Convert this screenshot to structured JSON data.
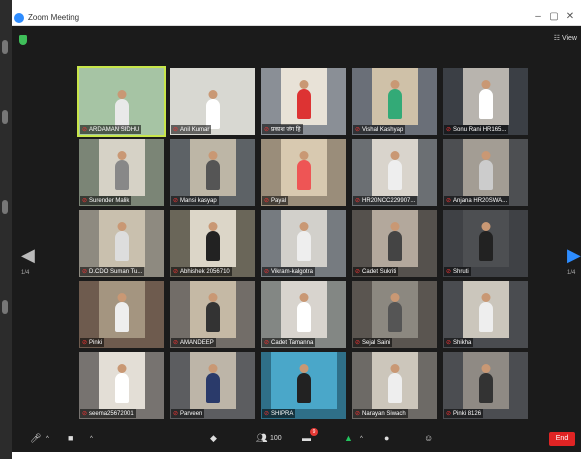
{
  "window": {
    "title": "Zoom Meeting",
    "minimize": "–",
    "restore": "▢",
    "close": "✕"
  },
  "header": {
    "view_label": "☷ View"
  },
  "gallery": {
    "page_left": "1/4",
    "page_right": "1/4",
    "participants": [
      "ARDAMAN SIDHU",
      "Anil Kumar",
      "प्रकाश जंग हि",
      "Vishal Kashyap",
      "Sonu Rani HR165...",
      "Surender Malik",
      "Mansi kasyap",
      "Payal",
      "HR20NCC229907...",
      "Anjana HR20SWA...",
      "D.CDO Suman Tu...",
      "Abhishek 2056710",
      "Vikram-kalgotra",
      "Cadet Sukriti",
      "Shruti",
      "Pinki",
      "AMANDEEP",
      "Cadet Tamanna",
      "Sejal Saini",
      "Shikha",
      "seema25672001",
      "Parveen",
      "SHIPRA",
      "Narayan Siwach",
      "Pinki 8126"
    ]
  },
  "toolbar": {
    "participants_count": "100",
    "chat_badge": "9",
    "end_label": "End"
  },
  "colors": {
    "accent": "#2d8cff",
    "end": "#e02424",
    "active_border": "#c8e64a"
  }
}
